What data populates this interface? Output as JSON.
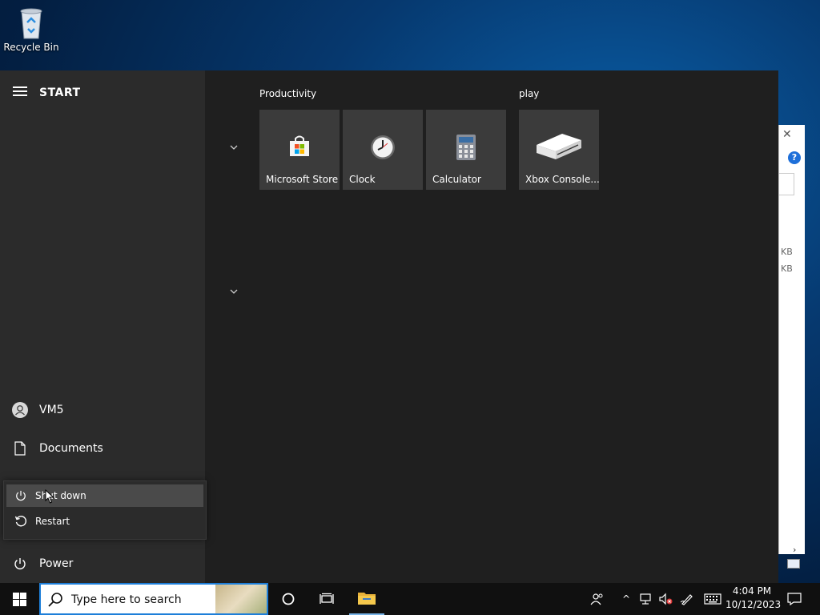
{
  "desktop": {
    "recycle_bin_label": "Recycle Bin"
  },
  "background_window": {
    "close_glyph": "✕",
    "help_glyph": "?",
    "size_unit_1": "KB",
    "size_unit_2": "KB",
    "scroll_glyph": "›"
  },
  "start_menu": {
    "title": "START",
    "user": "VM5",
    "documents": "Documents",
    "power": "Power",
    "power_menu": {
      "shut_down": "Shut down",
      "restart": "Restart"
    },
    "groups": [
      {
        "title": "Productivity",
        "tiles": [
          {
            "label": "Microsoft Store",
            "icon": "store-icon"
          },
          {
            "label": "Clock",
            "icon": "clock-icon"
          },
          {
            "label": "Calculator",
            "icon": "calculator-icon"
          }
        ]
      },
      {
        "title": "play",
        "tiles": [
          {
            "label": "Xbox Console...",
            "icon": "xbox-console-icon"
          }
        ]
      }
    ]
  },
  "taskbar": {
    "search_placeholder": "Type here to search",
    "tray_chevron": "^",
    "time": "4:04 PM",
    "date": "10/12/2023"
  },
  "colors": {
    "accent": "#1e7fd9",
    "start_bg": "#1f1f1f",
    "start_left_bg": "#2b2b2b",
    "tile_bg": "#3b3b3b",
    "taskbar_bg": "#101010"
  }
}
